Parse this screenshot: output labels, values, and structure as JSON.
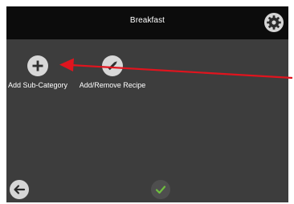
{
  "header": {
    "title": "Breakfast",
    "settings_icon": "gear-icon"
  },
  "actions": [
    {
      "label": "Add Sub-Category",
      "icon": "plus-icon"
    },
    {
      "label": "Add/Remove Recipe",
      "icon": "pencil-icon"
    }
  ],
  "footer": {
    "back_icon": "arrow-left-icon",
    "confirm_icon": "checkmark-icon"
  },
  "annotation": {
    "arrow_color": "#e0141e"
  },
  "colors": {
    "screen_bg": "#3d3d3d",
    "topbar_bg": "#0c0c0c",
    "icon_circle": "#d8d8d8",
    "confirm_check": "#6fbf3f"
  }
}
